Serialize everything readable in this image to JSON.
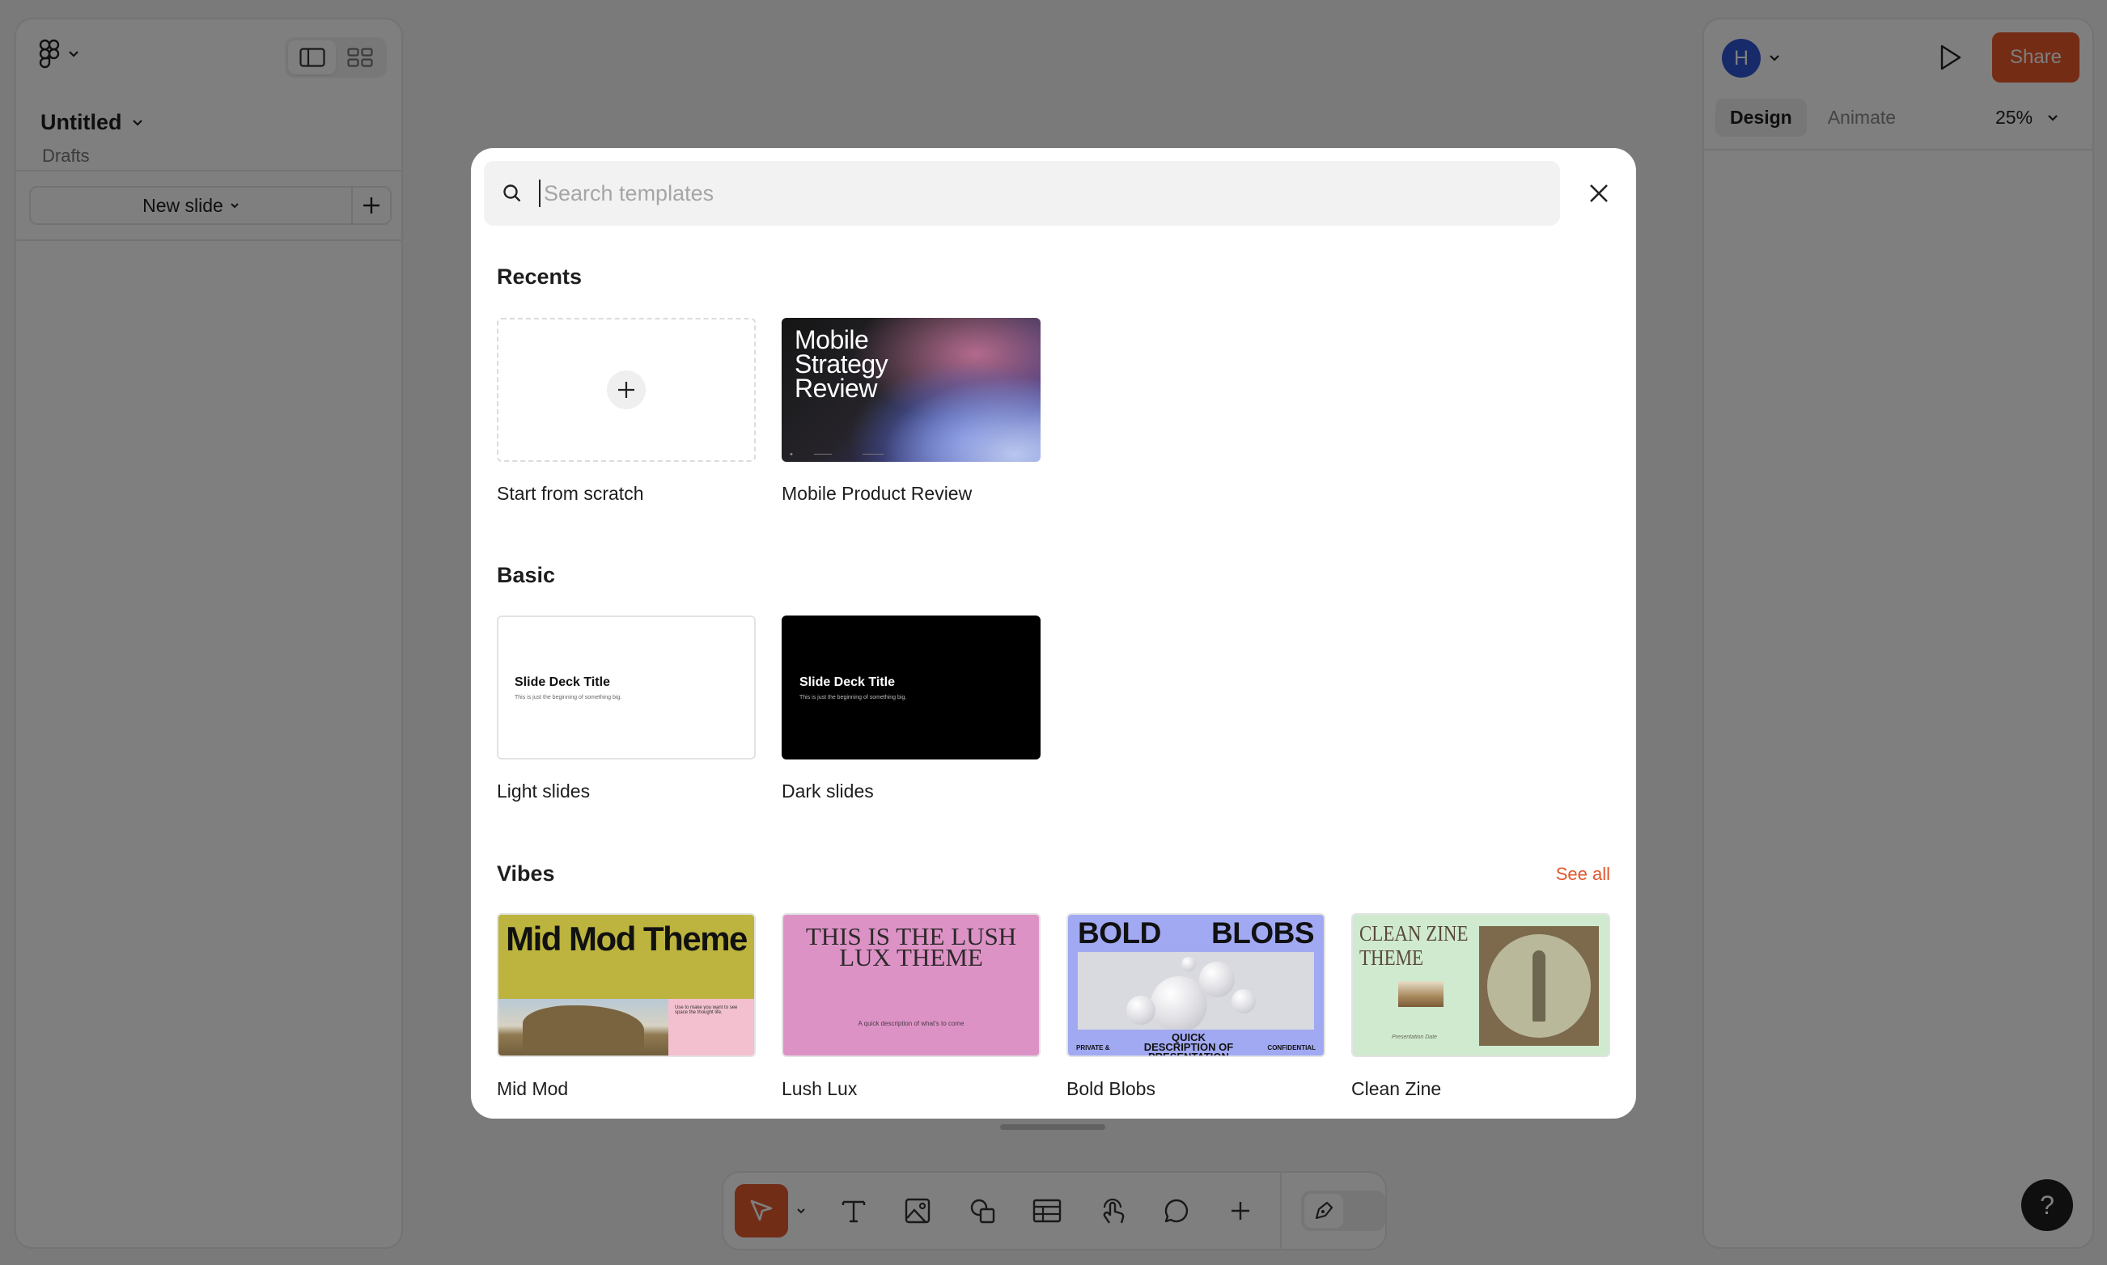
{
  "app": {
    "file_title": "Untitled",
    "file_location": "Drafts",
    "new_slide_label": "New slide",
    "avatar_initial": "H",
    "share_label": "Share",
    "tabs": [
      {
        "label": "Design",
        "active": true
      },
      {
        "label": "Animate",
        "active": false
      }
    ],
    "zoom": "25%",
    "help_label": "?",
    "accent_color": "#e8582a"
  },
  "modal": {
    "search_placeholder": "Search templates",
    "sections": {
      "recents": {
        "title": "Recents",
        "cards": [
          {
            "label": "Start from scratch"
          },
          {
            "label": "Mobile Product Review",
            "thumb_text": "Mobile Strategy Review"
          }
        ]
      },
      "basic": {
        "title": "Basic",
        "cards": [
          {
            "label": "Light slides",
            "thumb_title": "Slide Deck Title",
            "thumb_sub": "This is just the beginning of something big."
          },
          {
            "label": "Dark slides",
            "thumb_title": "Slide Deck Title",
            "thumb_sub": "This is just the beginning of something big."
          }
        ]
      },
      "vibes": {
        "title": "Vibes",
        "see_all": "See all",
        "cards": [
          {
            "label": "Mid Mod",
            "thumb_title": "Mid Mod Theme",
            "thumb_sub": "Use to make you want to see space the thought life."
          },
          {
            "label": "Lush Lux",
            "thumb_title": "THIS IS THE LUSH LUX THEME",
            "thumb_sub": "A quick description of what's to come"
          },
          {
            "label": "Bold Blobs",
            "thumb_left": "BOLD",
            "thumb_right": "BLOBS",
            "thumb_foot_left": "PRIVATE &",
            "thumb_foot_mid": "QUICK DESCRIPTION OF PRESENTATION",
            "thumb_foot_right": "CONFIDENTIAL"
          },
          {
            "label": "Clean Zine",
            "thumb_title": "CLEAN ZINE THEME",
            "thumb_sub": "Presentation Date"
          }
        ]
      }
    }
  }
}
